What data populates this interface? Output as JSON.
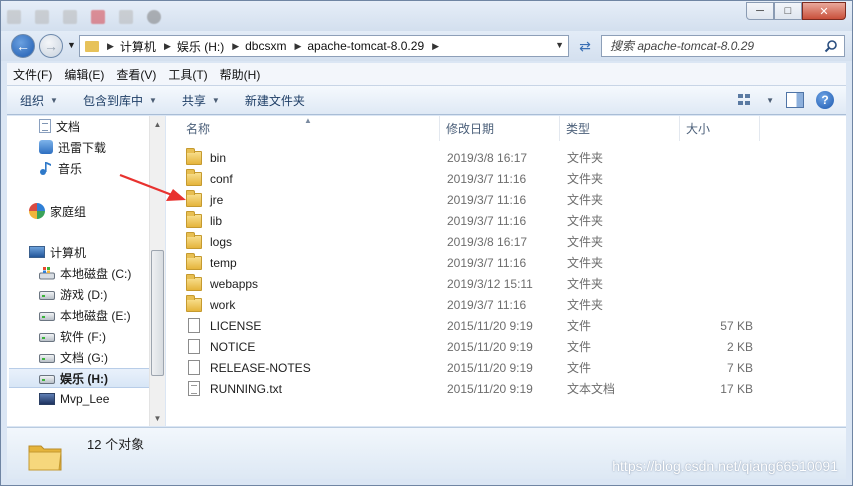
{
  "tabs": [
    "",
    "",
    "",
    "",
    "",
    "",
    ""
  ],
  "address": {
    "crumbs": [
      "计算机",
      "娱乐 (H:)",
      "dbcsxm",
      "apache-tomcat-8.0.29"
    ]
  },
  "search": {
    "placeholder": "搜索 apache-tomcat-8.0.29"
  },
  "menu": [
    "文件(F)",
    "编辑(E)",
    "查看(V)",
    "工具(T)",
    "帮助(H)"
  ],
  "toolbar": {
    "organize": "组织",
    "include_library": "包含到库中",
    "share": "共享",
    "new_folder": "新建文件夹"
  },
  "nav": {
    "items": [
      {
        "label": "文档",
        "icon": "document-icon"
      },
      {
        "label": "迅雷下载",
        "icon": "download-icon"
      },
      {
        "label": "音乐",
        "icon": "music-icon"
      },
      {
        "label": "家庭组",
        "icon": "homegroup-icon"
      },
      {
        "label": "计算机",
        "icon": "computer-icon"
      },
      {
        "label": "本地磁盘 (C:)",
        "icon": "system-drive-icon"
      },
      {
        "label": "游戏 (D:)",
        "icon": "drive-icon"
      },
      {
        "label": "本地磁盘 (E:)",
        "icon": "drive-icon"
      },
      {
        "label": "软件 (F:)",
        "icon": "drive-icon"
      },
      {
        "label": "文档 (G:)",
        "icon": "drive-icon"
      },
      {
        "label": "娱乐 (H:)",
        "icon": "drive-icon",
        "selected": true
      },
      {
        "label": "Mvp_Lee",
        "icon": "network-drive-icon"
      }
    ]
  },
  "columns": {
    "name": "名称",
    "date": "修改日期",
    "type": "类型",
    "size": "大小"
  },
  "files": [
    {
      "name": "bin",
      "date": "2019/3/8 16:17",
      "type": "文件夹",
      "size": "",
      "kind": "folder"
    },
    {
      "name": "conf",
      "date": "2019/3/7 11:16",
      "type": "文件夹",
      "size": "",
      "kind": "folder"
    },
    {
      "name": "jre",
      "date": "2019/3/7 11:16",
      "type": "文件夹",
      "size": "",
      "kind": "folder"
    },
    {
      "name": "lib",
      "date": "2019/3/7 11:16",
      "type": "文件夹",
      "size": "",
      "kind": "folder"
    },
    {
      "name": "logs",
      "date": "2019/3/8 16:17",
      "type": "文件夹",
      "size": "",
      "kind": "folder"
    },
    {
      "name": "temp",
      "date": "2019/3/7 11:16",
      "type": "文件夹",
      "size": "",
      "kind": "folder"
    },
    {
      "name": "webapps",
      "date": "2019/3/12 15:11",
      "type": "文件夹",
      "size": "",
      "kind": "folder"
    },
    {
      "name": "work",
      "date": "2019/3/7 11:16",
      "type": "文件夹",
      "size": "",
      "kind": "folder"
    },
    {
      "name": "LICENSE",
      "date": "2015/11/20 9:19",
      "type": "文件",
      "size": "57 KB",
      "kind": "file"
    },
    {
      "name": "NOTICE",
      "date": "2015/11/20 9:19",
      "type": "文件",
      "size": "2 KB",
      "kind": "file"
    },
    {
      "name": "RELEASE-NOTES",
      "date": "2015/11/20 9:19",
      "type": "文件",
      "size": "7 KB",
      "kind": "file"
    },
    {
      "name": "RUNNING.txt",
      "date": "2015/11/20 9:19",
      "type": "文本文档",
      "size": "17 KB",
      "kind": "text"
    }
  ],
  "status": {
    "count": "12 个对象"
  },
  "watermark": "https://blog.csdn.net/qiang66510091",
  "colors": {
    "folder": "#e5b43c",
    "arrow": "#e8322f",
    "accent": "#1e5bb0"
  }
}
